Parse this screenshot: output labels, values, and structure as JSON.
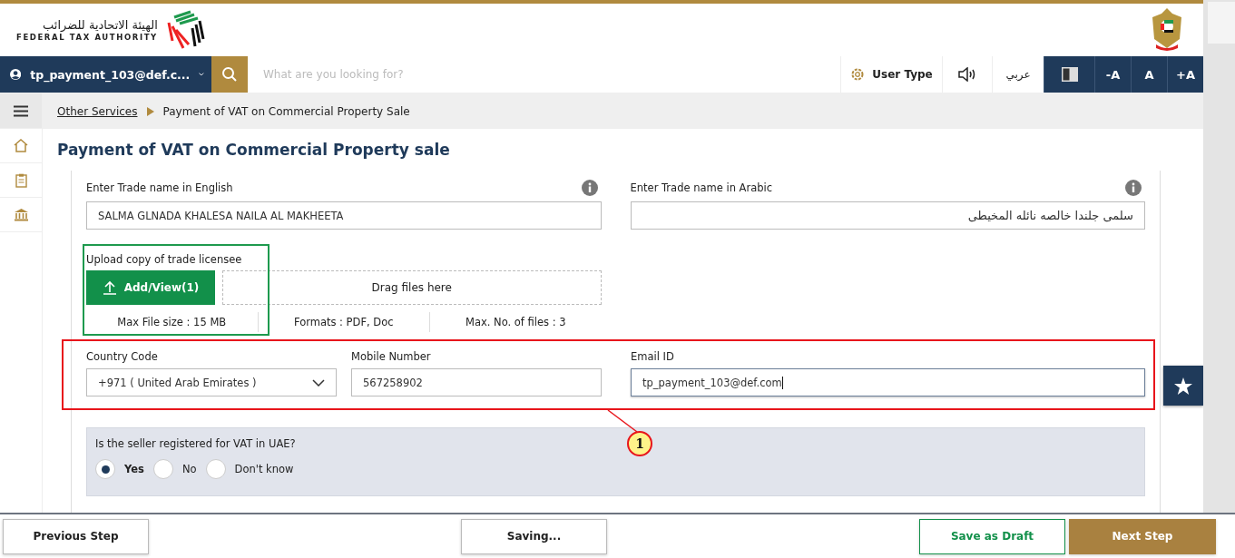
{
  "header": {
    "logo_arabic": "الهيئة الاتحادية للضرائب",
    "logo_english": "FEDERAL TAX AUTHORITY"
  },
  "navbar": {
    "user": "tp_payment_103@def.c...",
    "search_placeholder": "What are you looking for?",
    "user_type": "User Type",
    "language": "عربي",
    "font_buttons": [
      "-A",
      "A",
      "+A"
    ]
  },
  "breadcrumb": [
    {
      "label": "Other Services",
      "link": true
    },
    {
      "label": "Payment of VAT on Commercial Property Sale",
      "link": false
    }
  ],
  "page_title": "Payment of VAT on Commercial Property sale",
  "form": {
    "trade_name_english": {
      "label": "Enter Trade name in English",
      "value": "SALMA GLNADA KHALESA NAILA AL MAKHEETA"
    },
    "trade_name_arabic": {
      "label": "Enter Trade name in Arabic",
      "value": "سلمى جلندا خالصه نائله المخيطى"
    },
    "upload": {
      "label": "Upload copy of trade licensee",
      "button": "Add/View(1)",
      "drop": "Drag files here",
      "info": [
        "Max File size : 15 MB",
        "Formats : PDF, Doc",
        "Max. No. of files : 3"
      ]
    },
    "country_code": {
      "label": "Country Code",
      "value": "+971 ( United Arab Emirates )"
    },
    "mobile": {
      "label": "Mobile Number",
      "value": "567258902"
    },
    "email": {
      "label": "Email ID",
      "value": "tp_payment_103@def.com",
      "focused": true
    },
    "vat_question": {
      "label": "Is the seller registered for VAT in UAE?",
      "options": [
        {
          "label": "Yes",
          "selected": true
        },
        {
          "label": "No",
          "selected": false
        },
        {
          "label": "Don't know",
          "selected": false
        }
      ]
    }
  },
  "annotations": [
    {
      "kind": "upload",
      "color": "#1e9a4e"
    },
    {
      "kind": "contact",
      "color": "#e8151b",
      "callout": "1"
    }
  ],
  "footer": [
    {
      "label": "Previous Step",
      "kind": "plain"
    },
    {
      "label": "Saving...",
      "kind": "plain"
    },
    {
      "label": "Save as Draft",
      "kind": "outline"
    },
    {
      "label": "Next Step",
      "kind": "primary"
    }
  ]
}
